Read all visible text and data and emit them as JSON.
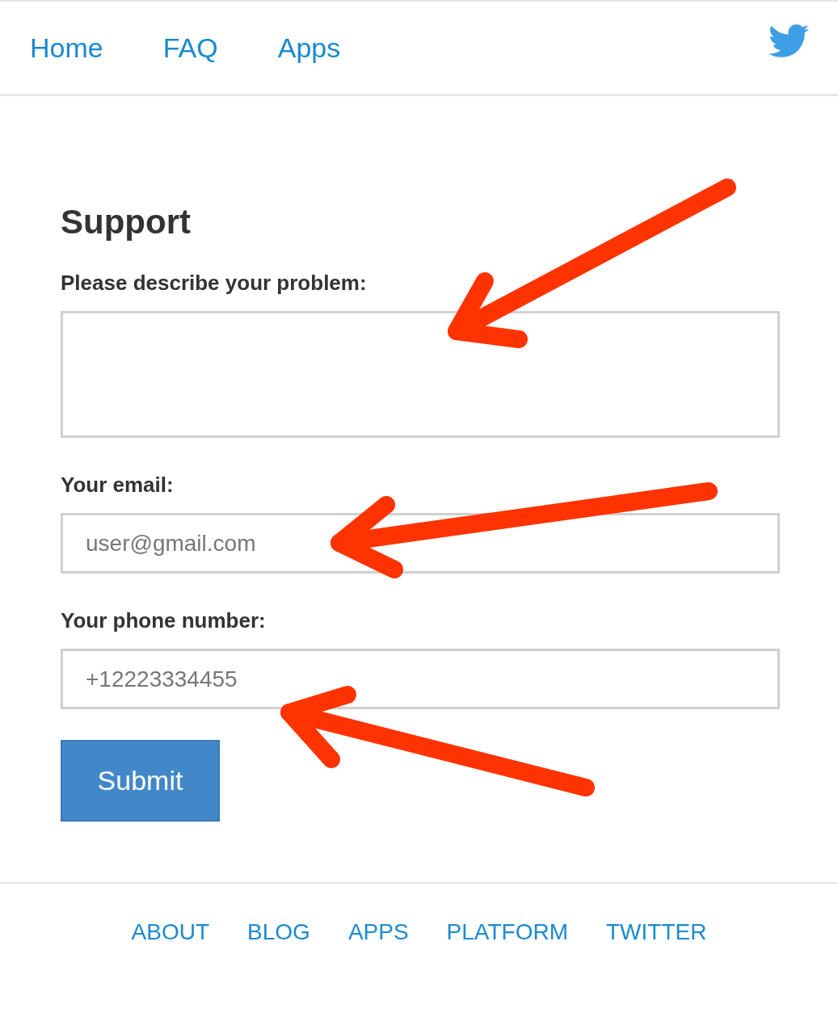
{
  "nav": {
    "links": [
      {
        "label": "Home"
      },
      {
        "label": "FAQ"
      },
      {
        "label": "Apps"
      }
    ]
  },
  "form": {
    "title": "Support",
    "fields": [
      {
        "kind": "textarea",
        "label": "Please describe your problem:"
      },
      {
        "kind": "input",
        "label": "Your email:",
        "placeholder": "user@gmail.com"
      },
      {
        "kind": "input",
        "label": "Your phone number:",
        "placeholder": "+12223334455"
      }
    ],
    "submit": "Submit"
  },
  "footer": {
    "links": [
      "ABOUT",
      "BLOG",
      "APPS",
      "PLATFORM",
      "TWITTER"
    ]
  }
}
